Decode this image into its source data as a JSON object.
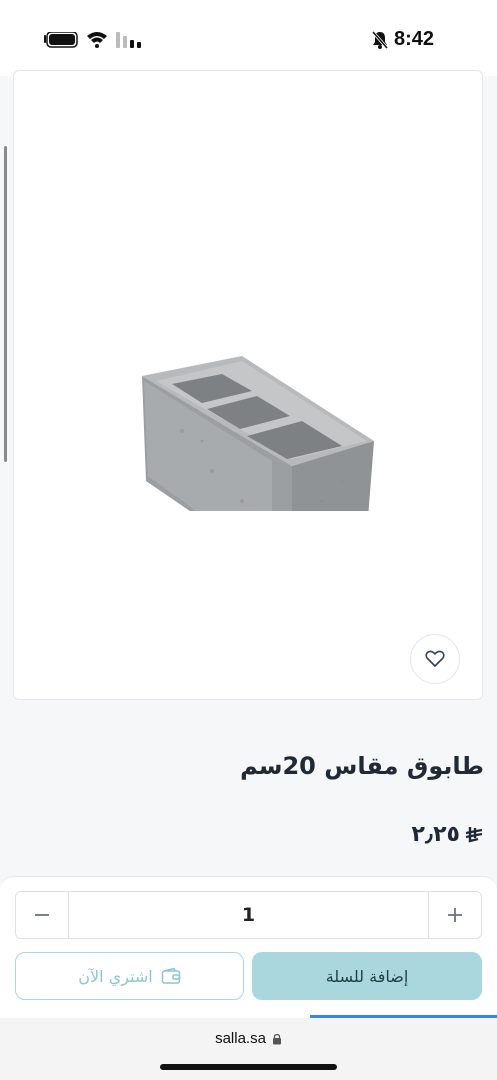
{
  "status_bar": {
    "time": "8:42",
    "battery_icon": "battery-icon",
    "wifi_icon": "wifi-icon",
    "signal_icon": "signal-icon",
    "silent_icon": "bell-slash-icon"
  },
  "product": {
    "image_alt": "concrete-block-icon",
    "title": "طابوق مقاس 20سم",
    "price": "٢٫٢٥",
    "currency_icon": "riyal-icon"
  },
  "cart": {
    "quantity": "1",
    "add_to_cart_label": "إضافة للسلة",
    "buy_now_label": "اشتري الآن"
  },
  "browser": {
    "url": "salla.sa"
  },
  "colors": {
    "accent": "#a9d7dd",
    "accent_text": "#8cc7cf",
    "progress": "#3b82f6"
  }
}
